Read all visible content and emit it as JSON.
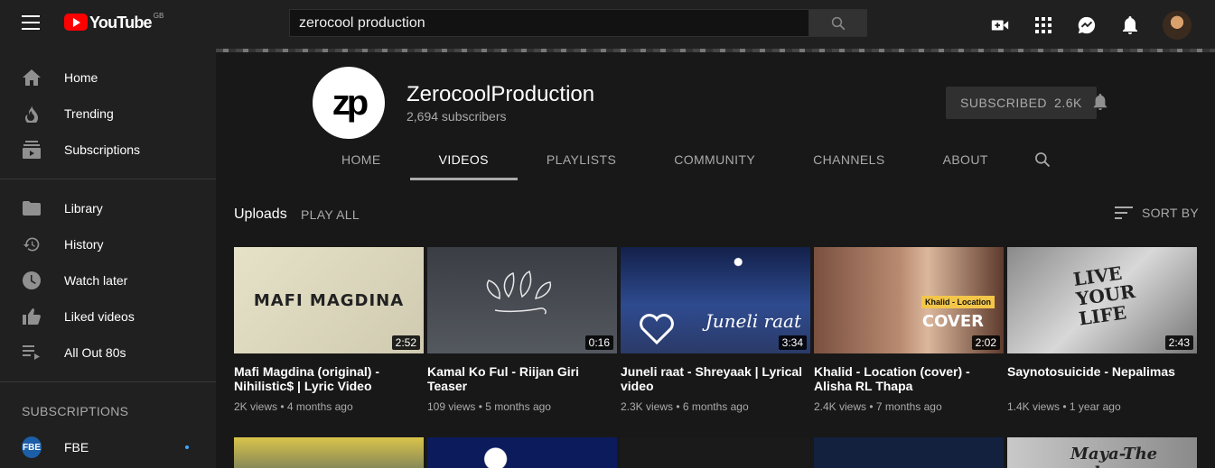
{
  "header": {
    "logo_text": "YouTube",
    "logo_region": "GB",
    "search_value": "zerocool production",
    "icons": [
      "create-video-icon",
      "apps-icon",
      "messages-icon",
      "notifications-icon"
    ]
  },
  "sidebar": {
    "primary": [
      {
        "label": "Home",
        "icon": "home-icon"
      },
      {
        "label": "Trending",
        "icon": "trending-icon"
      },
      {
        "label": "Subscriptions",
        "icon": "subscriptions-icon"
      }
    ],
    "library": [
      {
        "label": "Library",
        "icon": "library-icon"
      },
      {
        "label": "History",
        "icon": "history-icon"
      },
      {
        "label": "Watch later",
        "icon": "watch-later-icon"
      },
      {
        "label": "Liked videos",
        "icon": "liked-videos-icon"
      },
      {
        "label": "All Out 80s",
        "icon": "playlist-icon"
      }
    ],
    "subscriptions_title": "SUBSCRIPTIONS",
    "subscriptions": [
      {
        "label": "FBE",
        "avatar_text": "FBE"
      }
    ]
  },
  "channel": {
    "avatar_text": "zp",
    "name": "ZerocoolProduction",
    "subscribers": "2,694 subscribers",
    "subscribed_label": "SUBSCRIBED",
    "subscribed_count": "2.6K",
    "tabs": [
      "HOME",
      "VIDEOS",
      "PLAYLISTS",
      "COMMUNITY",
      "CHANNELS",
      "ABOUT"
    ],
    "active_tab": "VIDEOS"
  },
  "uploads": {
    "title": "Uploads",
    "play_all": "PLAY ALL",
    "sort_by": "SORT BY",
    "videos": [
      {
        "title": "Mafi Magdina (original) - Nihilistic$ | Lyric Video",
        "views": "2K views",
        "age": "4 months ago",
        "duration": "2:52",
        "thumb_text": "MAFI MAGDINA"
      },
      {
        "title": "Kamal Ko Ful - Riijan Giri Teaser",
        "views": "109 views",
        "age": "5 months ago",
        "duration": "0:16",
        "thumb_text": ""
      },
      {
        "title": "Juneli raat - Shreyaak | Lyrical video",
        "views": "2.3K views",
        "age": "6 months ago",
        "duration": "3:34",
        "thumb_text": "Juneli raat"
      },
      {
        "title": "Khalid - Location (cover) - Alisha RL Thapa",
        "views": "2.4K views",
        "age": "7 months ago",
        "duration": "2:02",
        "thumb_text": "Khalid - Location",
        "thumb_text2": "COVER"
      },
      {
        "title": "Saynotosuicide - Nepalimas",
        "views": "1.4K views",
        "age": "1 year ago",
        "duration": "2:43",
        "thumb_text": "LIVE YOUR LIFE"
      }
    ],
    "row2_text": "Maya-The uglyz"
  },
  "colors": {
    "background": "#181818",
    "surface": "#202020",
    "brand_red": "#ff0000",
    "text_secondary": "#aaaaaa",
    "accent_blue": "#3ea6ff"
  }
}
